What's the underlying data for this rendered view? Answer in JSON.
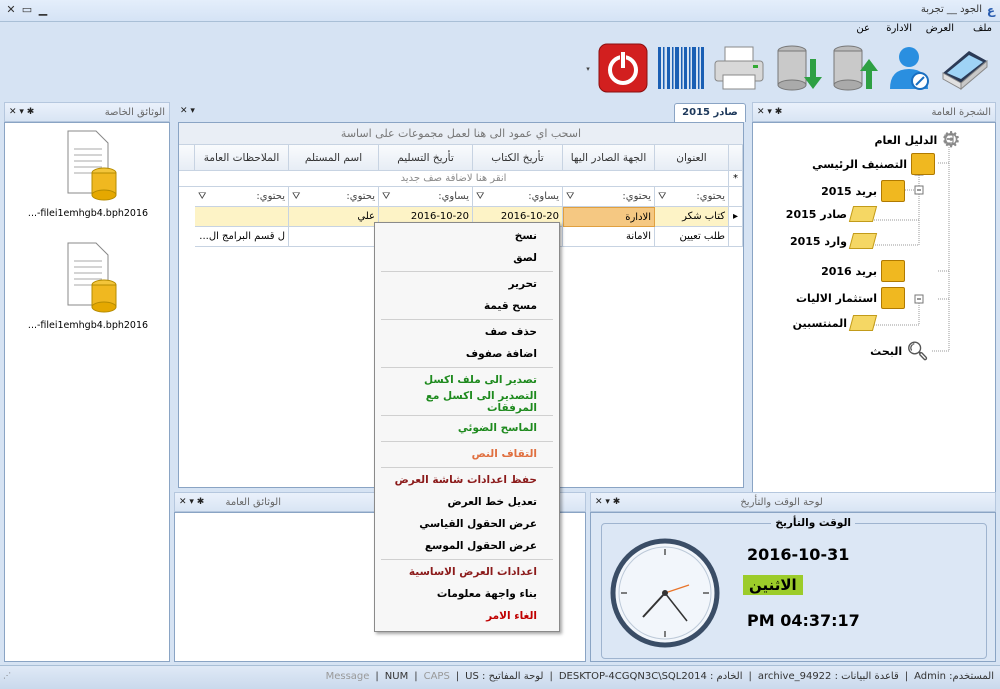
{
  "window": {
    "title": "الجود __ تجربة"
  },
  "menu": [
    "ملف",
    "العرض",
    "الادارة",
    "عن"
  ],
  "toolbar": {
    "buttons": [
      "scanner-icon",
      "user-edit-icon",
      "database-upload-icon",
      "database-download-icon",
      "printer-icon",
      "barcode-icon",
      "power-icon"
    ]
  },
  "tree_panel": {
    "title": "الشجرة العامة",
    "root": "الدليل العام",
    "items": [
      "التصنيف الرئيسي",
      "بريد 2015",
      "صادر 2015",
      "وارد 2015",
      "بريد 2016",
      "استثمار الاليات",
      "المنتسبين",
      "البحث"
    ]
  },
  "private_docs": {
    "title": "الوثائق الخاصة",
    "files": [
      "...-filei1emhgb4.bph2016",
      "...-filei1emhgb4.bph2016"
    ]
  },
  "main": {
    "tab": "صادر 2015",
    "group_hint": "اسحب اي عمود الى هنا لعمل مجموعات على اساسة",
    "new_row_hint": "انقر هنا لاضافة صف جديد",
    "columns": [
      "العنوان",
      "الجهة الصادر اليها",
      "تأريخ الكتاب",
      "تأريخ التسليم",
      "اسم المستلم",
      "الملاحظات العامة"
    ],
    "filters": [
      "يحتوي:",
      "يحتوي:",
      "يساوي:",
      "يساوي:",
      "يحتوي:",
      "يحتوي:"
    ],
    "rows": [
      [
        "كتاب شكر",
        "الادارة",
        "2016-10-20",
        "2016-10-20",
        "علي",
        ""
      ],
      [
        "طلب تعيين",
        "الامانة",
        "",
        "",
        "",
        "ل قسم البرامج ال..."
      ]
    ]
  },
  "public_docs": {
    "title": "الوثائق العامة"
  },
  "clock_panel": {
    "title": "لوحة الوقت والتأريخ",
    "group_label": "الوقت والتأريخ",
    "date": "2016-10-31",
    "day": "الاثنين",
    "time": "PM 04:37:17"
  },
  "context_menu": [
    {
      "label": "نسخ",
      "color": "#000000"
    },
    {
      "label": "لصق",
      "color": "#000000"
    },
    {
      "label": "تحرير",
      "color": "#000000"
    },
    {
      "label": "مسح قيمة",
      "color": "#000000"
    },
    {
      "label": "حذف صف",
      "color": "#000000"
    },
    {
      "label": "اضافة صفوف",
      "color": "#000000"
    },
    {
      "label": "تصدير الى ملف اكسل",
      "color": "#1e8a1e"
    },
    {
      "label": "التصدير الى اكسل مع المرفقات",
      "color": "#1e8a1e"
    },
    {
      "label": "الماسح الضوئي",
      "color": "#1e8a1e"
    },
    {
      "label": "التقاف النص",
      "color": "#e07040"
    },
    {
      "label": "حفظ اعدادات شاشة العرض",
      "color": "#8b1a1a"
    },
    {
      "label": "تعديل خط العرض",
      "color": "#000000"
    },
    {
      "label": "عرض الحقول القياسي",
      "color": "#000000"
    },
    {
      "label": "عرض الحقول الموسع",
      "color": "#000000"
    },
    {
      "label": "اعدادات العرض الاساسية",
      "color": "#8b1a1a"
    },
    {
      "label": "بناء واجهة معلومات",
      "color": "#000000"
    },
    {
      "label": "الغاء الامر",
      "color": "#c00000"
    }
  ],
  "status": {
    "user": "المستخدم: Admin",
    "db": "قاعدة البيانات : archive_94922",
    "server": "الخادم : DESKTOP-4CGQN3C\\SQL2014",
    "keyboard": "لوحة المفاتيح : US",
    "caps": "CAPS",
    "num": "NUM",
    "message": "Message"
  }
}
